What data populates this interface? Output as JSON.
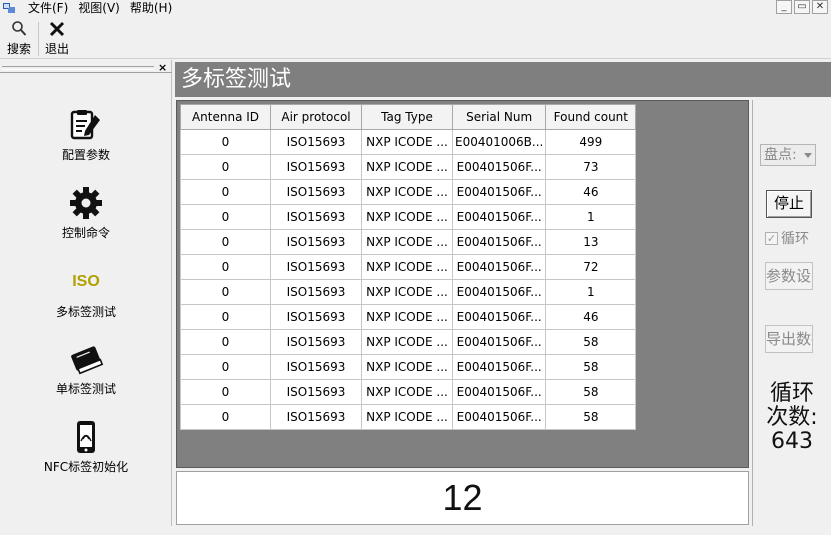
{
  "menu": {
    "file": "文件(F)",
    "view": "视图(V)",
    "help": "帮助(H)"
  },
  "window_controls": {
    "minimize": "_",
    "restore": "▭",
    "close": "✕"
  },
  "toolbar": {
    "search_label": "搜索",
    "exit_label": "退出"
  },
  "left_panel": {
    "close_glyph": "×",
    "items": [
      {
        "label": "配置参数",
        "icon": "clipboard-pencil-icon"
      },
      {
        "label": "控制命令",
        "icon": "gear-icon"
      },
      {
        "label": "多标签测试",
        "icon": "iso-icon",
        "icon_text": "ISO"
      },
      {
        "label": "单标签测试",
        "icon": "book-icon"
      },
      {
        "label": "NFC标签初始化",
        "icon": "phone-nfc-icon"
      }
    ]
  },
  "main": {
    "title": "多标签测试",
    "table": {
      "headers": [
        "Antenna ID",
        "Air protocol",
        "Tag Type",
        "Serial Num",
        "Found count"
      ],
      "rows": [
        [
          "0",
          "ISO15693",
          "NXP ICODE ...",
          "E00401006B...",
          "499"
        ],
        [
          "0",
          "ISO15693",
          "NXP ICODE ...",
          "E00401506F...",
          "73"
        ],
        [
          "0",
          "ISO15693",
          "NXP ICODE ...",
          "E00401506F...",
          "46"
        ],
        [
          "0",
          "ISO15693",
          "NXP ICODE ...",
          "E00401506F...",
          "1"
        ],
        [
          "0",
          "ISO15693",
          "NXP ICODE ...",
          "E00401506F...",
          "13"
        ],
        [
          "0",
          "ISO15693",
          "NXP ICODE ...",
          "E00401506F...",
          "72"
        ],
        [
          "0",
          "ISO15693",
          "NXP ICODE ...",
          "E00401506F...",
          "1"
        ],
        [
          "0",
          "ISO15693",
          "NXP ICODE ...",
          "E00401506F...",
          "46"
        ],
        [
          "0",
          "ISO15693",
          "NXP ICODE ...",
          "E00401506F...",
          "58"
        ],
        [
          "0",
          "ISO15693",
          "NXP ICODE ...",
          "E00401506F...",
          "58"
        ],
        [
          "0",
          "ISO15693",
          "NXP ICODE ...",
          "E00401506F...",
          "58"
        ],
        [
          "0",
          "ISO15693",
          "NXP ICODE ...",
          "E00401506F...",
          "58"
        ]
      ]
    },
    "tag_count": "12"
  },
  "right_panel": {
    "mode_select": "盘点",
    "stop_button": "停止",
    "loop_checkbox": {
      "label": "循环",
      "checked": true
    },
    "param_button": "参数设置",
    "export_button": "导出数据",
    "loop_count_label": "循环\n次数:",
    "loop_count_value": "643"
  },
  "colors": {
    "title_bar": "#7f7f7f",
    "table_background": "#808080",
    "iso_icon": "#b0a000"
  }
}
